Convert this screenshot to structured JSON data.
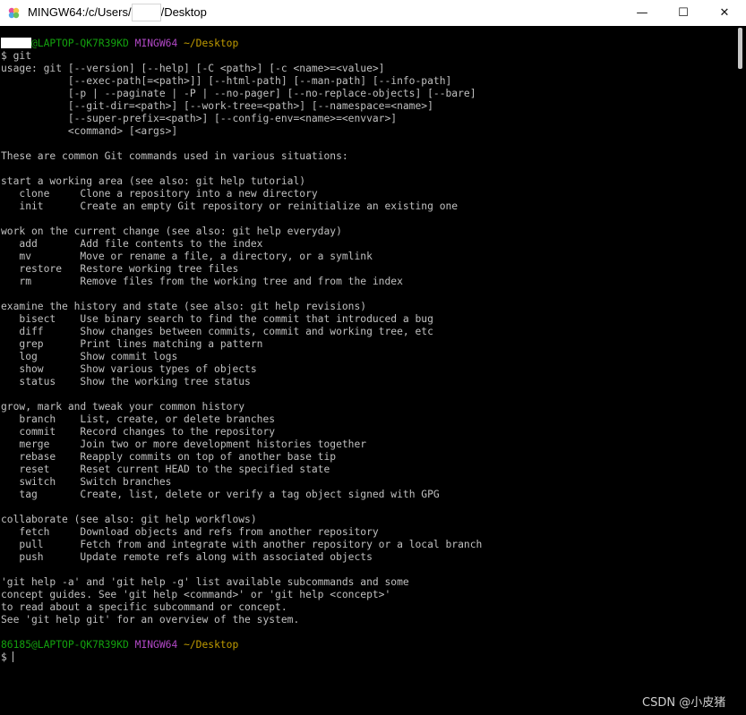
{
  "window": {
    "title_prefix": "MINGW64:/c/Users/",
    "title_suffix": "/Desktop",
    "minimize_glyph": "—",
    "maximize_glyph": "☐",
    "close_glyph": "✕",
    "icon": "mingw-icon"
  },
  "prompt1": {
    "user_host": "@LAPTOP-QK7R39KD",
    "env": "MINGW64",
    "path": "~/Desktop"
  },
  "command_line": "$ git",
  "usage": [
    "usage: git [--version] [--help] [-C <path>] [-c <name>=<value>]",
    "           [--exec-path[=<path>]] [--html-path] [--man-path] [--info-path]",
    "           [-p | --paginate | -P | --no-pager] [--no-replace-objects] [--bare]",
    "           [--git-dir=<path>] [--work-tree=<path>] [--namespace=<name>]",
    "           [--super-prefix=<path>] [--config-env=<name>=<envvar>]",
    "           <command> [<args>]"
  ],
  "intro": "These are common Git commands used in various situations:",
  "sections": [
    {
      "heading": "start a working area (see also: git help tutorial)",
      "commands": [
        {
          "name": "clone",
          "desc": "Clone a repository into a new directory"
        },
        {
          "name": "init",
          "desc": "Create an empty Git repository or reinitialize an existing one"
        }
      ]
    },
    {
      "heading": "work on the current change (see also: git help everyday)",
      "commands": [
        {
          "name": "add",
          "desc": "Add file contents to the index"
        },
        {
          "name": "mv",
          "desc": "Move or rename a file, a directory, or a symlink"
        },
        {
          "name": "restore",
          "desc": "Restore working tree files"
        },
        {
          "name": "rm",
          "desc": "Remove files from the working tree and from the index"
        }
      ]
    },
    {
      "heading": "examine the history and state (see also: git help revisions)",
      "commands": [
        {
          "name": "bisect",
          "desc": "Use binary search to find the commit that introduced a bug"
        },
        {
          "name": "diff",
          "desc": "Show changes between commits, commit and working tree, etc"
        },
        {
          "name": "grep",
          "desc": "Print lines matching a pattern"
        },
        {
          "name": "log",
          "desc": "Show commit logs"
        },
        {
          "name": "show",
          "desc": "Show various types of objects"
        },
        {
          "name": "status",
          "desc": "Show the working tree status"
        }
      ]
    },
    {
      "heading": "grow, mark and tweak your common history",
      "commands": [
        {
          "name": "branch",
          "desc": "List, create, or delete branches"
        },
        {
          "name": "commit",
          "desc": "Record changes to the repository"
        },
        {
          "name": "merge",
          "desc": "Join two or more development histories together"
        },
        {
          "name": "rebase",
          "desc": "Reapply commits on top of another base tip"
        },
        {
          "name": "reset",
          "desc": "Reset current HEAD to the specified state"
        },
        {
          "name": "switch",
          "desc": "Switch branches"
        },
        {
          "name": "tag",
          "desc": "Create, list, delete or verify a tag object signed with GPG"
        }
      ]
    },
    {
      "heading": "collaborate (see also: git help workflows)",
      "commands": [
        {
          "name": "fetch",
          "desc": "Download objects and refs from another repository"
        },
        {
          "name": "pull",
          "desc": "Fetch from and integrate with another repository or a local branch"
        },
        {
          "name": "push",
          "desc": "Update remote refs along with associated objects"
        }
      ]
    }
  ],
  "footer": [
    "'git help -a' and 'git help -g' list available subcommands and some",
    "concept guides. See 'git help <command>' or 'git help <concept>'",
    "to read about a specific subcommand or concept.",
    "See 'git help git' for an overview of the system."
  ],
  "prompt2": {
    "user_host": "86185@LAPTOP-QK7R39KD",
    "env": "MINGW64",
    "path": "~/Desktop"
  },
  "final_prompt": "$",
  "watermark": "CSDN @小皮猪",
  "colors": {
    "prompt_user": "#13a10e",
    "prompt_env": "#b148c6",
    "prompt_path": "#c19c00",
    "text": "#c0c0c0",
    "background": "#000000"
  }
}
